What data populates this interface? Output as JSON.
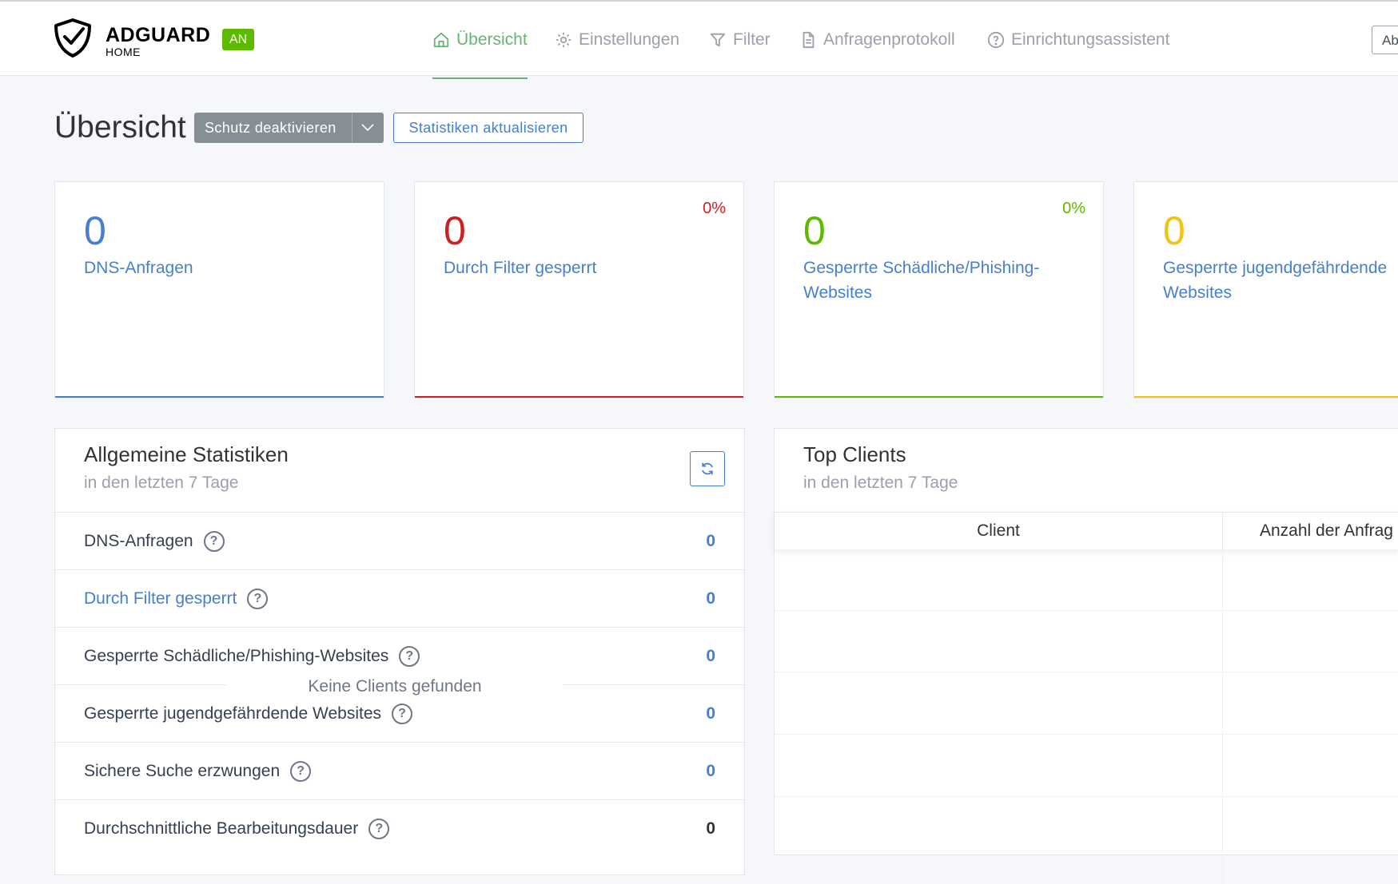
{
  "brand": {
    "title": "ADGUARD",
    "subtitle": "HOME",
    "status_badge": "AN"
  },
  "colors": {
    "accent_green": "#66b574",
    "blue": "#467fcf",
    "red": "#cd201f",
    "green": "#5eba00",
    "yellow": "#f1c40f"
  },
  "nav": [
    {
      "label": "Übersicht",
      "icon": "home-icon",
      "active": true
    },
    {
      "label": "Einstellungen",
      "icon": "gear-icon",
      "active": false
    },
    {
      "label": "Filter",
      "icon": "filter-icon",
      "active": false
    },
    {
      "label": "Anfragenprotokoll",
      "icon": "document-icon",
      "active": false
    },
    {
      "label": "Einrichtungsassistent",
      "icon": "help-circle-icon",
      "active": false
    }
  ],
  "header_button": "Ab",
  "page": {
    "title": "Übersicht",
    "toggle_button": "Schutz deaktivieren",
    "refresh_button": "Statistiken aktualisieren"
  },
  "counters": [
    {
      "value": "0",
      "label": "DNS-Anfragen",
      "percent": ""
    },
    {
      "value": "0",
      "label": "Durch Filter gesperrt",
      "percent": "0%"
    },
    {
      "value": "0",
      "label": "Gesperrte Schädliche/Phishing-Websites",
      "percent": "0%"
    },
    {
      "value": "0",
      "label": "Gesperrte jugendgefährdende Websites",
      "percent": ""
    }
  ],
  "general_stats": {
    "title": "Allgemeine Statistiken",
    "subtitle": "in den letzten 7 Tage",
    "rows": [
      {
        "label": "DNS-Anfragen",
        "value": "0"
      },
      {
        "label": "Durch Filter gesperrt",
        "value": "0"
      },
      {
        "label": "Gesperrte Schädliche/Phishing-Websites",
        "value": "0"
      },
      {
        "label": "Gesperrte jugendgefährdende Websites",
        "value": "0"
      },
      {
        "label": "Sichere Suche erzwungen",
        "value": "0"
      },
      {
        "label": "Durchschnittliche Bearbeitungsdauer",
        "value": "0"
      }
    ],
    "help_glyph": "?"
  },
  "top_clients": {
    "title": "Top Clients",
    "subtitle": "in den letzten 7 Tage",
    "columns": [
      "Client",
      "Anzahl der Anfrag"
    ],
    "empty_message": "Keine Clients gefunden"
  }
}
